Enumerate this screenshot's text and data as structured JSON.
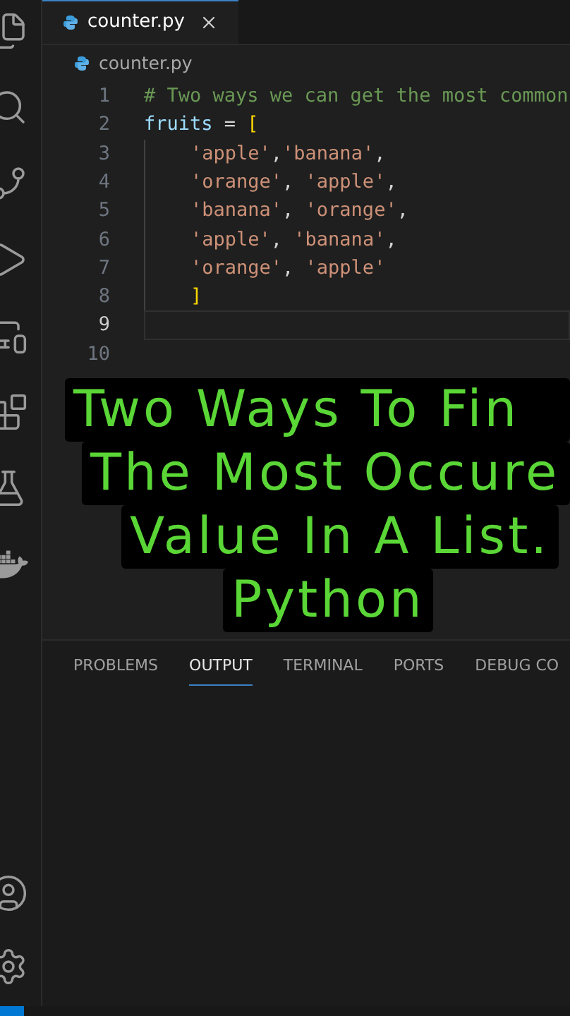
{
  "editor_tabs": [
    {
      "label": "counter.py",
      "selected": true
    }
  ],
  "breadcrumb": "counter.py",
  "code_lines": [
    {
      "number": "1",
      "current": false,
      "tokens": [
        {
          "kind": "comment",
          "text": "# Two ways we can get the most common"
        }
      ]
    },
    {
      "number": "2",
      "current": false,
      "tokens": [
        {
          "kind": "name",
          "text": "fruits"
        },
        {
          "kind": "op",
          "text": " = "
        },
        {
          "kind": "bracket",
          "text": "["
        }
      ],
      "children": [
        {
          "number": "3",
          "current": false,
          "tokens": [
            {
              "kind": "string",
              "text": "'apple'"
            },
            {
              "kind": "op",
              "text": ","
            },
            {
              "kind": "string",
              "text": "'banana'"
            },
            {
              "kind": "op",
              "text": ","
            }
          ]
        },
        {
          "number": "4",
          "current": false,
          "tokens": [
            {
              "kind": "string",
              "text": "'orange'"
            },
            {
              "kind": "op",
              "text": ", "
            },
            {
              "kind": "string",
              "text": "'apple'"
            },
            {
              "kind": "op",
              "text": ","
            }
          ]
        },
        {
          "number": "5",
          "current": false,
          "tokens": [
            {
              "kind": "string",
              "text": "'banana'"
            },
            {
              "kind": "op",
              "text": ", "
            },
            {
              "kind": "string",
              "text": "'orange'"
            },
            {
              "kind": "op",
              "text": ","
            }
          ]
        },
        {
          "number": "6",
          "current": false,
          "tokens": [
            {
              "kind": "string",
              "text": "'apple'"
            },
            {
              "kind": "op",
              "text": ", "
            },
            {
              "kind": "string",
              "text": "'banana'"
            },
            {
              "kind": "op",
              "text": ","
            }
          ]
        },
        {
          "number": "7",
          "current": false,
          "tokens": [
            {
              "kind": "string",
              "text": "'orange'"
            },
            {
              "kind": "op",
              "text": ", "
            },
            {
              "kind": "string",
              "text": "'apple'"
            }
          ]
        },
        {
          "number": "8",
          "current": false,
          "tokens": [
            {
              "kind": "bracket",
              "text": "]"
            }
          ]
        }
      ]
    },
    {
      "number": "9",
      "current": true
    },
    {
      "number": "10",
      "current": false
    }
  ],
  "caption_lines": [
    "Two Ways To Fin",
    "The Most Occure",
    "Value In A List.",
    "Python"
  ],
  "panel_tabs": [
    {
      "label": "PROBLEMS",
      "selected": false
    },
    {
      "label": "OUTPUT",
      "selected": true
    },
    {
      "label": "TERMINAL",
      "selected": false
    },
    {
      "label": "PORTS",
      "selected": false
    },
    {
      "label": "DEBUG CO",
      "selected": false
    }
  ]
}
